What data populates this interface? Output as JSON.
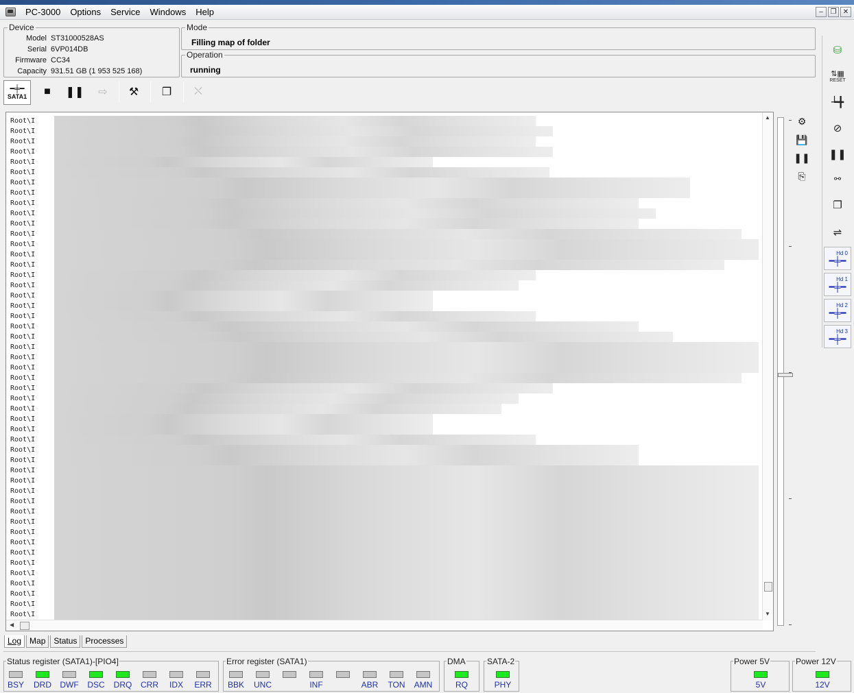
{
  "window": {
    "title": "PC-3000",
    "menu": [
      "Options",
      "Service",
      "Windows",
      "Help"
    ]
  },
  "device": {
    "group_title": "Device",
    "fields": [
      {
        "label": "Model",
        "value": "ST31000528AS"
      },
      {
        "label": "Serial",
        "value": "6VP014DB"
      },
      {
        "label": "Firmware",
        "value": "CC34"
      },
      {
        "label": "Capacity",
        "value": "931.51 GB (1 953 525 168)"
      }
    ]
  },
  "mode": {
    "group_title": "Mode",
    "value": "Filling map of folder"
  },
  "operation": {
    "group_title": "Operation",
    "value": "running"
  },
  "toolbar": {
    "sata_label": "SATA1"
  },
  "log": {
    "row_prefix": "Root\\I",
    "row_count": 49
  },
  "right_toolbar": {
    "reset_label": "RESET",
    "hd_labels": [
      "Hd 0",
      "Hd 1",
      "Hd 2",
      "Hd 3"
    ]
  },
  "tabs": [
    "Log",
    "Map",
    "Status",
    "Processes"
  ],
  "status_register": {
    "title": "Status register (SATA1)-[PIO4]",
    "leds": [
      {
        "label": "BSY",
        "on": false
      },
      {
        "label": "DRD",
        "on": true
      },
      {
        "label": "DWF",
        "on": false
      },
      {
        "label": "DSC",
        "on": true
      },
      {
        "label": "DRQ",
        "on": true
      },
      {
        "label": "CRR",
        "on": false
      },
      {
        "label": "IDX",
        "on": false
      },
      {
        "label": "ERR",
        "on": false
      }
    ]
  },
  "error_register": {
    "title": "Error register (SATA1)",
    "leds": [
      {
        "label": "BBK",
        "on": false
      },
      {
        "label": "UNC",
        "on": false
      },
      {
        "label": "",
        "on": false
      },
      {
        "label": "INF",
        "on": false
      },
      {
        "label": "",
        "on": false
      },
      {
        "label": "ABR",
        "on": false
      },
      {
        "label": "TON",
        "on": false
      },
      {
        "label": "AMN",
        "on": false
      }
    ]
  },
  "dma": {
    "title": "DMA",
    "led": {
      "label": "RQ",
      "on": true
    }
  },
  "sata2": {
    "title": "SATA-2",
    "led": {
      "label": "PHY",
      "on": true
    }
  },
  "power5": {
    "title": "Power 5V",
    "led": {
      "label": "5V",
      "on": true
    }
  },
  "power12": {
    "title": "Power 12V",
    "led": {
      "label": "12V",
      "on": true
    }
  },
  "colors": {
    "led_on": "#1ee81e",
    "led_off": "#c6c6c6",
    "led_label": "#2030b0"
  }
}
